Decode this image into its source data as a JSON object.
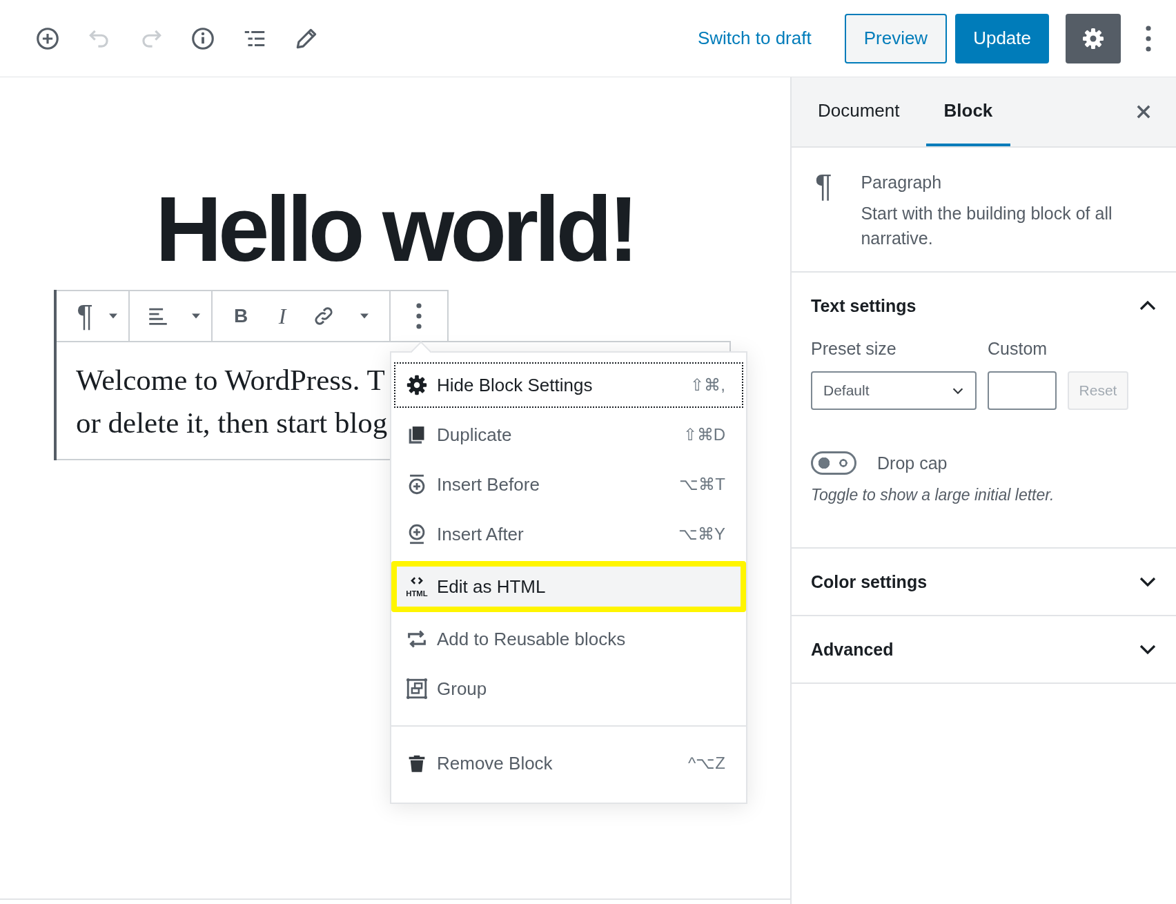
{
  "header": {
    "tools": [
      {
        "disabled": false
      },
      {
        "disabled": true
      },
      {
        "disabled": true
      },
      {
        "disabled": false
      },
      {
        "disabled": false
      },
      {
        "disabled": false
      }
    ],
    "switch_to_draft": "Switch to draft",
    "preview": "Preview",
    "update": "Update",
    "settings_pressed": true
  },
  "post": {
    "title": "Hello world!",
    "paragraph_lines": [
      "Welcome to WordPress. T",
      "or delete it, then start blog"
    ]
  },
  "block_toolbar": {
    "block_icon": "¶",
    "bold": "B",
    "italic": "I"
  },
  "menu": {
    "groups": [
      {
        "items": [
          {
            "label": "Hide Block Settings",
            "shortcut": "⇧⌘,",
            "focused": true,
            "highlighted": false
          },
          {
            "label": "Duplicate",
            "shortcut": "⇧⌘D",
            "focused": false,
            "highlighted": false
          },
          {
            "label": "Insert Before",
            "shortcut": "⌥⌘T",
            "focused": false,
            "highlighted": false
          },
          {
            "label": "Insert After",
            "shortcut": "⌥⌘Y",
            "focused": false,
            "highlighted": false
          },
          {
            "label": "Edit as HTML",
            "icon_label": "HTML",
            "focused": false,
            "highlighted": true
          },
          {
            "label": "Add to Reusable blocks",
            "focused": false,
            "highlighted": false
          },
          {
            "label": "Group",
            "focused": false,
            "highlighted": false
          }
        ]
      },
      {
        "items": [
          {
            "label": "Remove Block",
            "shortcut": "^⌥Z",
            "focused": false,
            "highlighted": false
          }
        ]
      }
    ]
  },
  "sidebar": {
    "tabs": [
      {
        "label": "Document",
        "selected": false
      },
      {
        "label": "Block",
        "selected": true
      }
    ],
    "block_card": {
      "icon": "¶",
      "title": "Paragraph",
      "description": "Start with the building block of all narrative."
    },
    "panels": [
      {
        "title": "Text settings",
        "expanded": true,
        "preset_label": "Preset size",
        "preset_value": "Default",
        "custom_label": "Custom",
        "reset": "Reset",
        "reset_disabled": true,
        "drop_cap": {
          "label": "Drop cap",
          "on": false,
          "help": "Toggle to show a large initial letter."
        }
      },
      {
        "title": "Color settings",
        "expanded": false
      },
      {
        "title": "Advanced",
        "expanded": false
      }
    ]
  }
}
